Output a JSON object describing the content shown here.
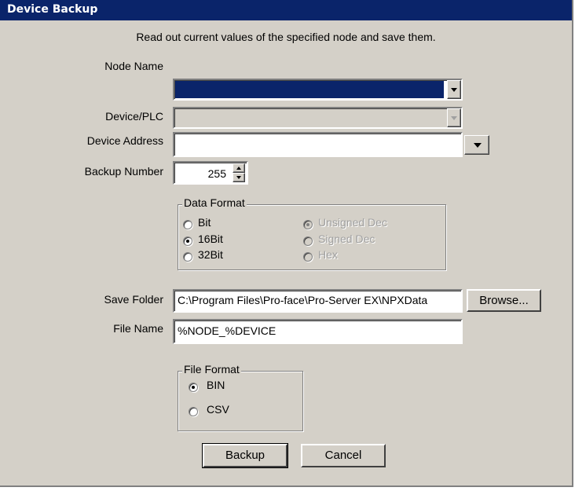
{
  "window": {
    "title": "Device Backup"
  },
  "description": "Read out current values of the specified node and save them.",
  "node_name": {
    "label": "Node Name",
    "value": ""
  },
  "device_plc": {
    "label": "Device/PLC",
    "value": ""
  },
  "device_address": {
    "label": "Device Address",
    "value": ""
  },
  "backup_number": {
    "label": "Backup Number",
    "value": "255"
  },
  "data_format": {
    "title": "Data Format",
    "options": {
      "bit": "Bit",
      "b16": "16Bit",
      "b32": "32Bit",
      "unsigned": "Unsigned Dec",
      "signed": "Signed Dec",
      "hex": "Hex"
    },
    "selected_size": "16Bit",
    "selected_type": "Unsigned Dec"
  },
  "save_folder": {
    "label": "Save Folder",
    "value": "C:\\Program Files\\Pro-face\\Pro-Server EX\\NPXData",
    "browse_label": "Browse..."
  },
  "file_name": {
    "label": "File Name",
    "value": "%NODE_%DEVICE"
  },
  "file_format": {
    "title": "File Format",
    "options": {
      "bin": "BIN",
      "csv": "CSV"
    },
    "selected": "BIN"
  },
  "buttons": {
    "backup": "Backup",
    "cancel": "Cancel"
  },
  "colors": {
    "titlebar": "#0a246a",
    "dialog_bg": "#d4d0c8",
    "selection": "#0a246a"
  }
}
